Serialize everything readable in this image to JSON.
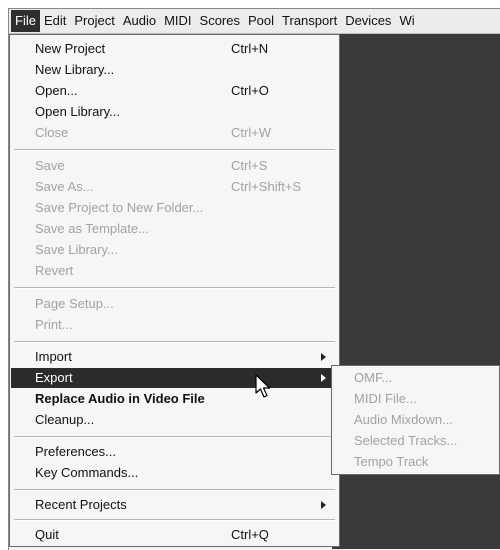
{
  "menubar": {
    "items": [
      {
        "label": "File"
      },
      {
        "label": "Edit"
      },
      {
        "label": "Project"
      },
      {
        "label": "Audio"
      },
      {
        "label": "MIDI"
      },
      {
        "label": "Scores"
      },
      {
        "label": "Pool"
      },
      {
        "label": "Transport"
      },
      {
        "label": "Devices"
      },
      {
        "label": "Wi"
      }
    ]
  },
  "file_menu": {
    "new_project": {
      "label": "New Project",
      "shortcut": "Ctrl+N"
    },
    "new_library": {
      "label": "New Library..."
    },
    "open": {
      "label": "Open...",
      "shortcut": "Ctrl+O"
    },
    "open_library": {
      "label": "Open Library..."
    },
    "close": {
      "label": "Close",
      "shortcut": "Ctrl+W"
    },
    "save": {
      "label": "Save",
      "shortcut": "Ctrl+S"
    },
    "save_as": {
      "label": "Save As...",
      "shortcut": "Ctrl+Shift+S"
    },
    "save_project_new_folder": {
      "label": "Save Project to New Folder..."
    },
    "save_as_template": {
      "label": "Save as Template..."
    },
    "save_library": {
      "label": "Save Library..."
    },
    "revert": {
      "label": "Revert"
    },
    "page_setup": {
      "label": "Page Setup..."
    },
    "print": {
      "label": "Print..."
    },
    "import": {
      "label": "Import"
    },
    "export": {
      "label": "Export"
    },
    "replace_audio": {
      "label": "Replace Audio in Video File"
    },
    "cleanup": {
      "label": "Cleanup..."
    },
    "preferences": {
      "label": "Preferences..."
    },
    "key_commands": {
      "label": "Key Commands..."
    },
    "recent_projects": {
      "label": "Recent Projects"
    },
    "quit": {
      "label": "Quit",
      "shortcut": "Ctrl+Q"
    }
  },
  "export_submenu": {
    "items": [
      {
        "label": "OMF..."
      },
      {
        "label": "MIDI File..."
      },
      {
        "label": "Audio Mixdown..."
      },
      {
        "label": "Selected Tracks..."
      },
      {
        "label": "Tempo Track"
      }
    ]
  },
  "colors": {
    "highlight": "#2b2b2b",
    "disabled_text": "#a2a2a2",
    "workspace": "#3a3a3a"
  }
}
